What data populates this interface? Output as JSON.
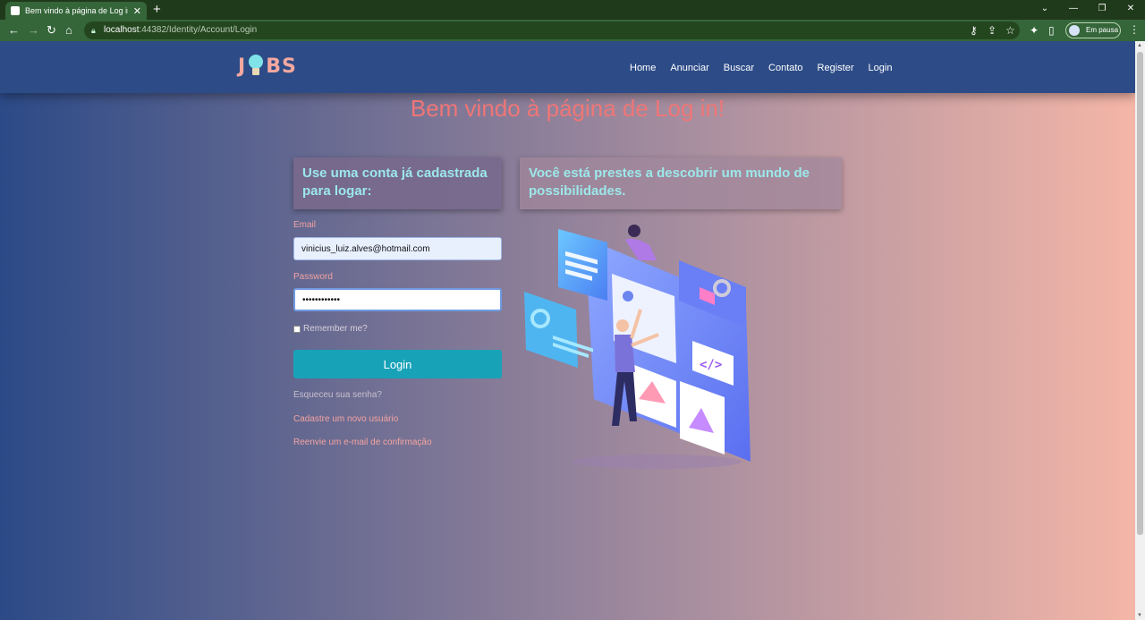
{
  "browser": {
    "tab_title": "Bem vindo à página de Log in! -",
    "new_tab": "+",
    "url_host": "localhost",
    "url_path": ":44382/Identity/Account/Login",
    "profile_label": "Em pausa",
    "win_min": "⌄",
    "win_minimize": "—",
    "win_restore": "❐",
    "win_close": "✕"
  },
  "navbar": {
    "logo_left": "J",
    "logo_right": "BS",
    "links": [
      "Home",
      "Anunciar",
      "Buscar",
      "Contato",
      "Register",
      "Login"
    ]
  },
  "page": {
    "title": "Bem vindo à página de Log in!",
    "left_card": "Use uma conta já cadastrada para logar:",
    "right_card": "Você está prestes a descobrir um mundo de possibilidades."
  },
  "form": {
    "email_label": "Email",
    "email_value": "vinicius_luiz.alves@hotmail.com",
    "password_label": "Password",
    "password_value": "••••••••••••",
    "remember_label": "Remember me?",
    "login_button": "Login",
    "forgot_link": "Esqueceu sua senha?",
    "register_link": "Cadastre um novo usuário",
    "resend_link": "Reenvie um e-mail de confirmação"
  },
  "colors": {
    "title": "#ef7676",
    "card_text": "#9ce8ea",
    "button": "#17a2b8",
    "navbar": "#2d4c87"
  }
}
